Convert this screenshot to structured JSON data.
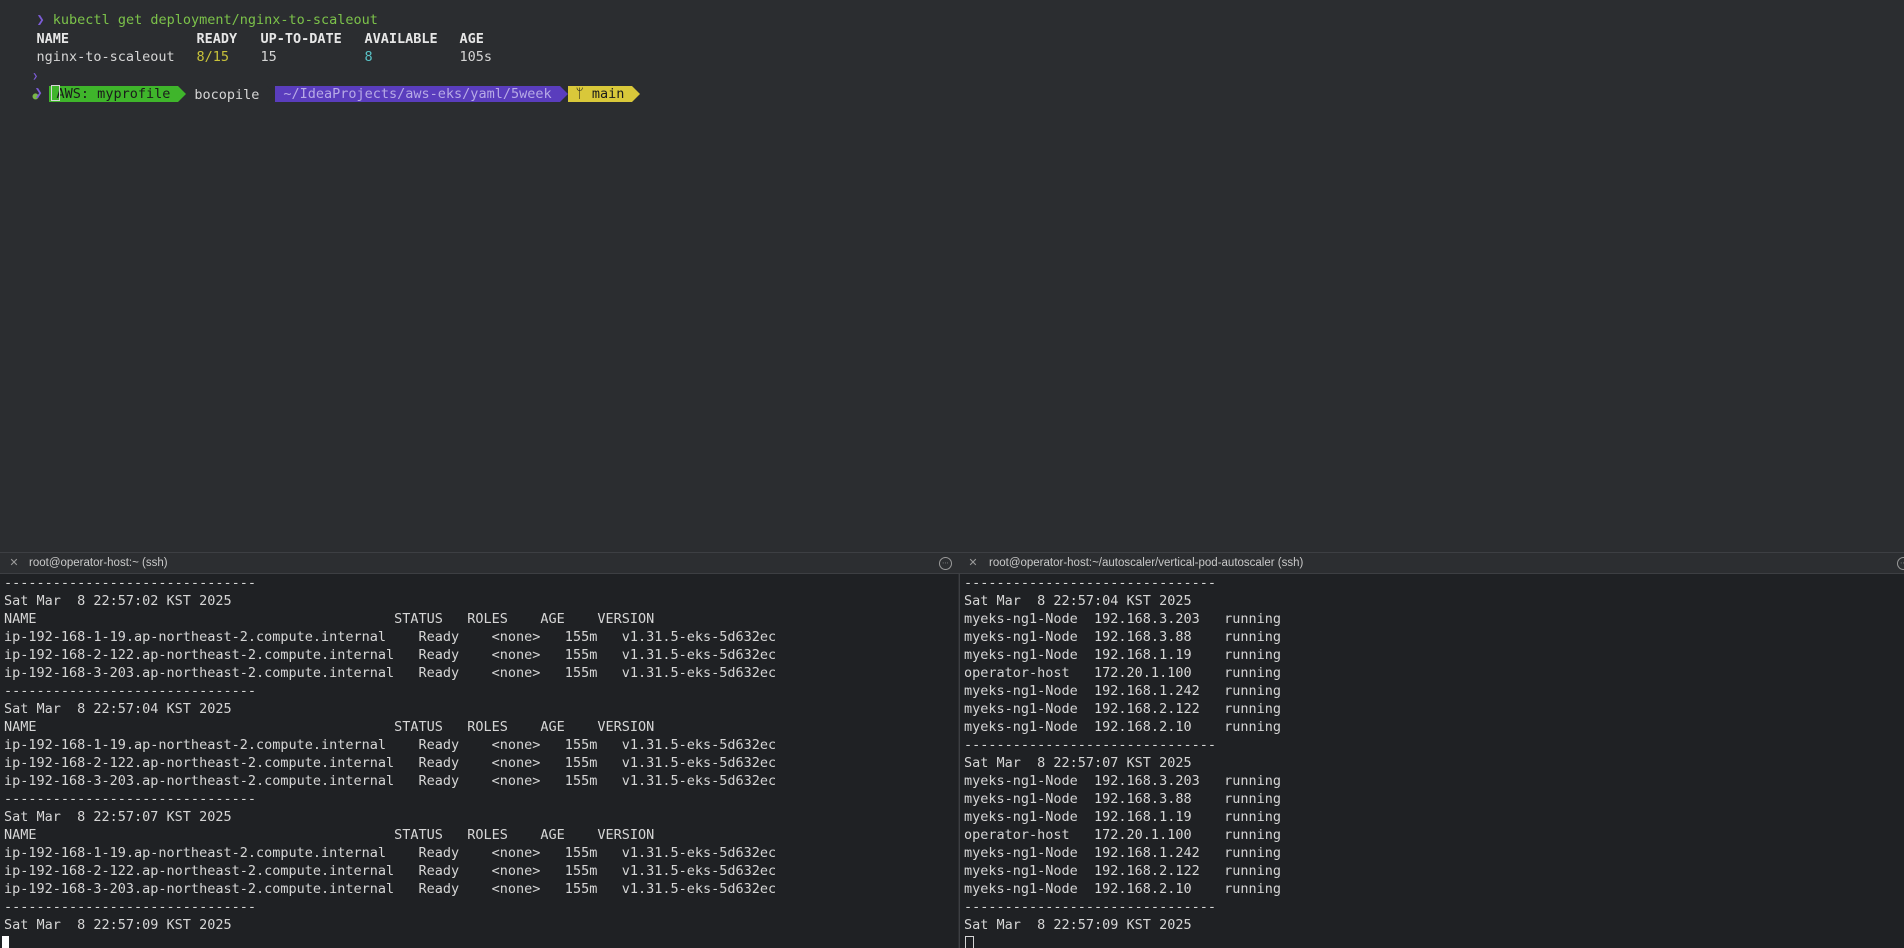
{
  "top": {
    "command_prompt": "❯",
    "command": "kubectl get deployment/nginx-to-scaleout",
    "headers": [
      "NAME",
      "READY",
      "UP-TO-DATE",
      "AVAILABLE",
      "AGE"
    ],
    "row": {
      "name": "nginx-to-scaleout",
      "ready": "8/15",
      "up_to_date": "15",
      "available": "8",
      "age": "105s"
    },
    "prompt": {
      "os_icon": "●",
      "aws": "AWS: myprofile",
      "user": "bocopile",
      "path": "~/IdeaProjects/aws-eks/yaml/5week",
      "git": "ᛘ main"
    },
    "prompt_arrow": "❯"
  },
  "tabs": {
    "left_title": "root@operator-host:~ (ssh)",
    "right_title": "root@operator-host:~/autoscaler/vertical-pod-autoscaler (ssh)",
    "close_glyph": "✕",
    "menu_glyph": "⋯"
  },
  "left_pane": {
    "separator": "-------------------------------",
    "node_header": "NAME                                            STATUS   ROLES    AGE    VERSION",
    "blocks": [
      {
        "timestamp": "Sat Mar  8 22:57:02 KST 2025",
        "rows": [
          "ip-192-168-1-19.ap-northeast-2.compute.internal    Ready    <none>   155m   v1.31.5-eks-5d632ec",
          "ip-192-168-2-122.ap-northeast-2.compute.internal   Ready    <none>   155m   v1.31.5-eks-5d632ec",
          "ip-192-168-3-203.ap-northeast-2.compute.internal   Ready    <none>   155m   v1.31.5-eks-5d632ec"
        ]
      },
      {
        "timestamp": "Sat Mar  8 22:57:04 KST 2025",
        "rows": [
          "ip-192-168-1-19.ap-northeast-2.compute.internal    Ready    <none>   155m   v1.31.5-eks-5d632ec",
          "ip-192-168-2-122.ap-northeast-2.compute.internal   Ready    <none>   155m   v1.31.5-eks-5d632ec",
          "ip-192-168-3-203.ap-northeast-2.compute.internal   Ready    <none>   155m   v1.31.5-eks-5d632ec"
        ]
      },
      {
        "timestamp": "Sat Mar  8 22:57:07 KST 2025",
        "rows": [
          "ip-192-168-1-19.ap-northeast-2.compute.internal    Ready    <none>   155m   v1.31.5-eks-5d632ec",
          "ip-192-168-2-122.ap-northeast-2.compute.internal   Ready    <none>   155m   v1.31.5-eks-5d632ec",
          "ip-192-168-3-203.ap-northeast-2.compute.internal   Ready    <none>   155m   v1.31.5-eks-5d632ec"
        ]
      }
    ],
    "last_timestamp": "Sat Mar  8 22:57:09 KST 2025"
  },
  "right_pane": {
    "separator": "-------------------------------",
    "blocks": [
      {
        "timestamp": "Sat Mar  8 22:57:04 KST 2025",
        "rows": [
          "myeks-ng1-Node  192.168.3.203   running",
          "myeks-ng1-Node  192.168.3.88    running",
          "myeks-ng1-Node  192.168.1.19    running",
          "operator-host   172.20.1.100    running",
          "myeks-ng1-Node  192.168.1.242   running",
          "myeks-ng1-Node  192.168.2.122   running",
          "myeks-ng1-Node  192.168.2.10    running"
        ]
      },
      {
        "timestamp": "Sat Mar  8 22:57:07 KST 2025",
        "rows": [
          "myeks-ng1-Node  192.168.3.203   running",
          "myeks-ng1-Node  192.168.3.88    running",
          "myeks-ng1-Node  192.168.1.19    running",
          "operator-host   172.20.1.100    running",
          "myeks-ng1-Node  192.168.1.242   running",
          "myeks-ng1-Node  192.168.2.122   running",
          "myeks-ng1-Node  192.168.2.10    running"
        ]
      }
    ],
    "last_timestamp": "Sat Mar  8 22:57:09 KST 2025"
  }
}
